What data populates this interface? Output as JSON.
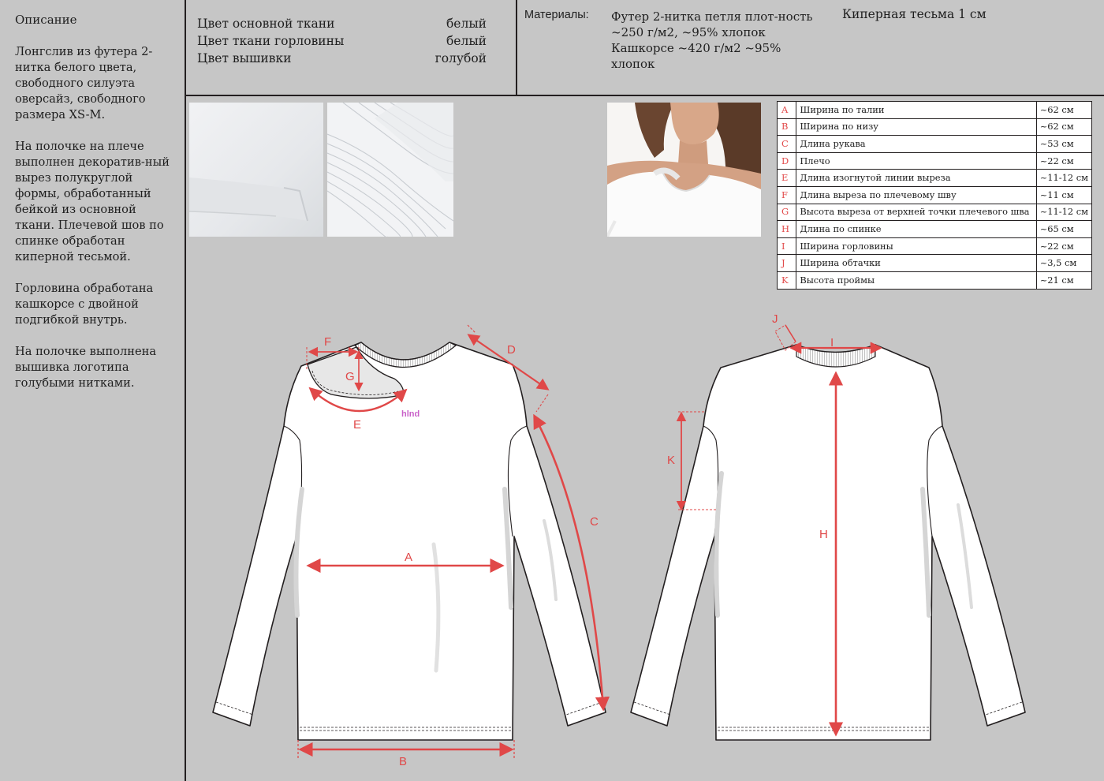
{
  "description": {
    "title": "Описание",
    "paragraphs": [
      "Лонгслив из футера 2-нитка белого цвета, свободного силуэта оверсайз, свободного размера XS-M.",
      "На полочке на плече выполнен декоратив-ный вырез полукруглой формы, обработанный бейкой из основной ткани. Плечевой шов по спинке обработан киперной тесьмой.",
      "Горловина обработана кашкорсе с двойной подгибкой внутрь.",
      "На полочке выполнена вышивка логотипа голубыми нитками."
    ]
  },
  "colors": [
    {
      "label": "Цвет основной ткани",
      "value": "белый"
    },
    {
      "label": "Цвет ткани горловины",
      "value": "белый"
    },
    {
      "label": "Цвет вышивки",
      "value": "голубой"
    }
  ],
  "materials": {
    "label": "Материалы:",
    "text": "Футер 2-нитка петля плот-ность ~250 г/м2, ~95% хлопок Кашкорсе ~420 г/м2 ~95% хлопок",
    "tape": "Киперная тесьма 1 см"
  },
  "measurements": [
    {
      "letter": "A",
      "name": "Ширина по талии",
      "value": "~62 см"
    },
    {
      "letter": "B",
      "name": "Ширина по низу",
      "value": "~62 см"
    },
    {
      "letter": "C",
      "name": "Длина рукава",
      "value": "~53 см"
    },
    {
      "letter": "D",
      "name": "Плечо",
      "value": "~22 см"
    },
    {
      "letter": "E",
      "name": "Длина изогнутой линии выреза",
      "value": "~11-12 см"
    },
    {
      "letter": "F",
      "name": "Длина выреза по плечевому шву",
      "value": "~11 см"
    },
    {
      "letter": "G",
      "name": "Высота выреза от верхней точки плечевого шва",
      "value": "~11-12 см"
    },
    {
      "letter": "H",
      "name": "Длина по спинке",
      "value": "~65 см"
    },
    {
      "letter": "I",
      "name": "Ширина горловины",
      "value": "~22 см"
    },
    {
      "letter": "J",
      "name": "Ширина обтачки",
      "value": "~3,5 см"
    },
    {
      "letter": "K",
      "name": "Высота проймы",
      "value": "~21 см"
    }
  ],
  "sketch": {
    "embroidery_logo": "hlnd",
    "accent_color": "#e04848",
    "logo_color": "#c960c9",
    "front_labels": {
      "a": "A",
      "b": "B",
      "c": "C",
      "d": "D",
      "e": "E",
      "f": "F",
      "g": "G"
    },
    "back_labels": {
      "h": "H",
      "i": "I",
      "j": "J",
      "k": "K"
    }
  }
}
